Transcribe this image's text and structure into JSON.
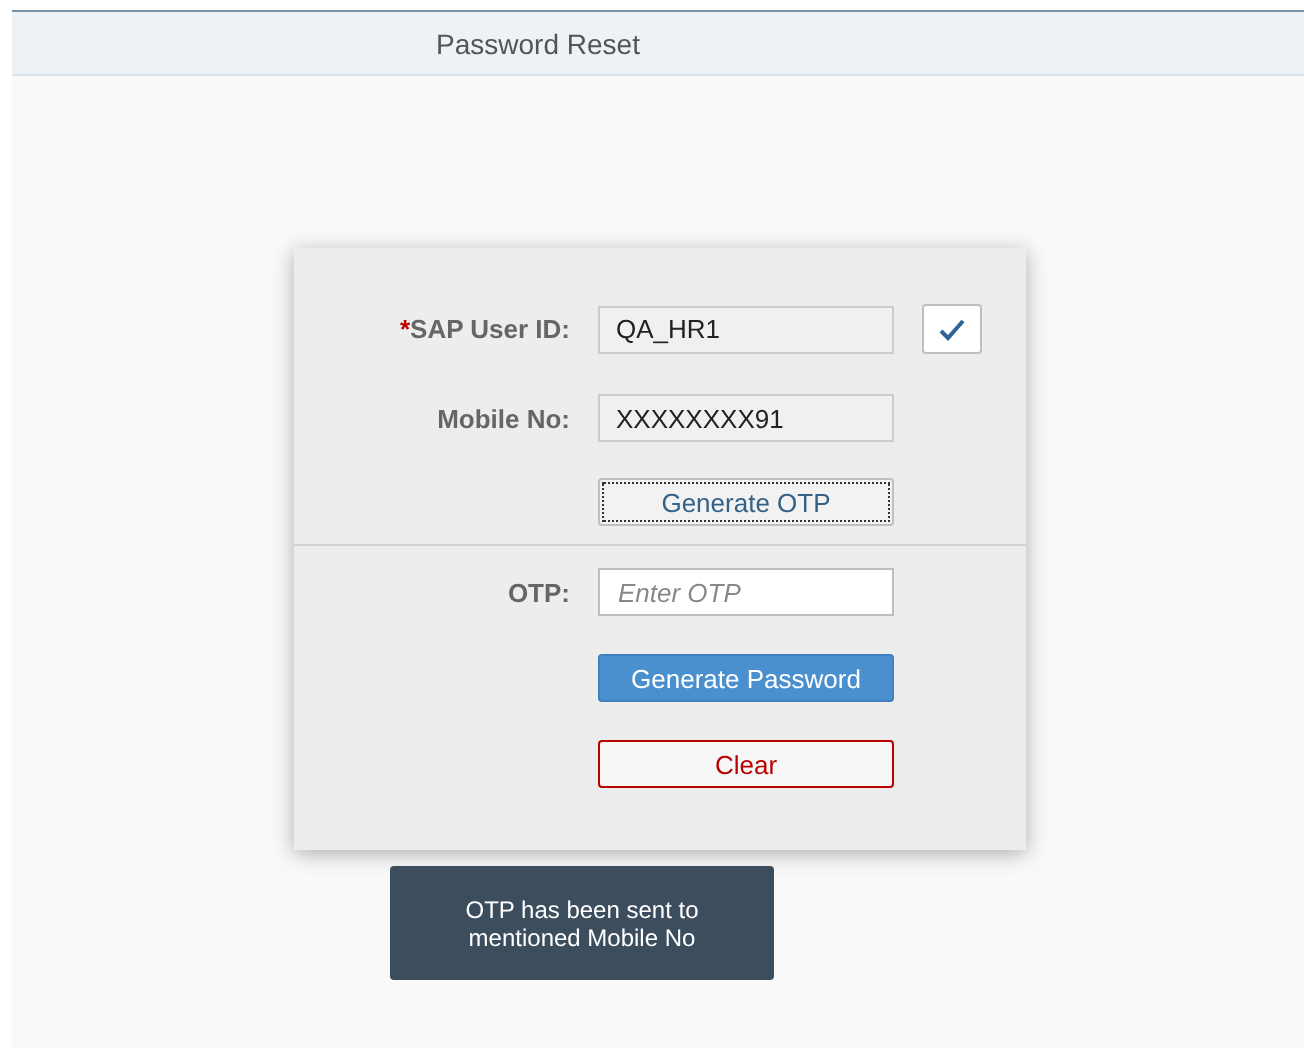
{
  "header": {
    "title": "Password Reset"
  },
  "user_id": {
    "required_mark": "*",
    "label": "SAP User ID:",
    "value": "QA_HR1"
  },
  "mobile": {
    "label": "Mobile No:",
    "value": "XXXXXXXX91"
  },
  "generate_otp": {
    "label": "Generate OTP",
    "kind": "default",
    "focused": true
  },
  "otp": {
    "label": "OTP:",
    "placeholder": "Enter OTP"
  },
  "actions": [
    {
      "label": "Generate Password",
      "kind": "emphasized",
      "focused": false
    },
    {
      "label": "Clear",
      "kind": "reject",
      "focused": false
    }
  ],
  "toast": {
    "message": "OTP has been sent to\nmentioned Mobile No"
  }
}
